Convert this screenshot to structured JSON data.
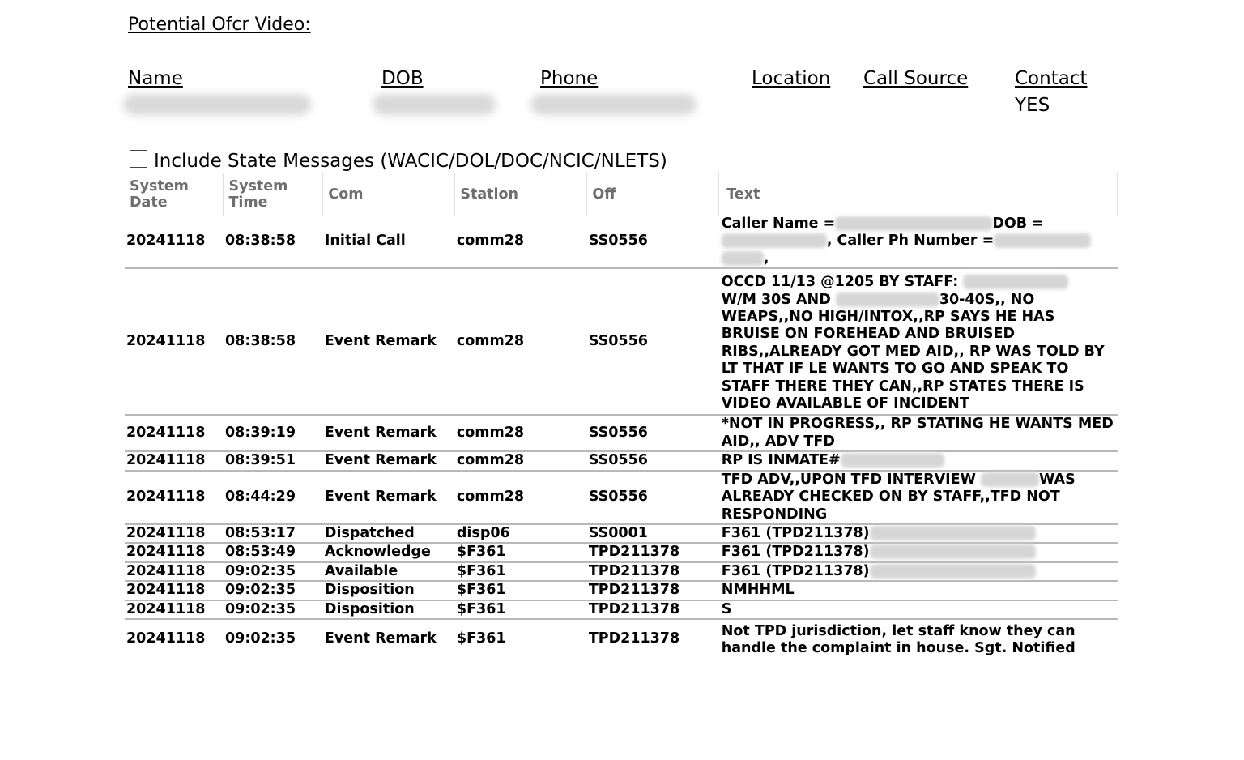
{
  "page_title": "Potential Ofcr Video:",
  "contact_headers": {
    "name": "Name",
    "dob": "DOB",
    "phone": "Phone",
    "location": "Location",
    "call_source": "Call Source",
    "contact": "Contact"
  },
  "contact_values": {
    "location": "",
    "call_source": "",
    "contact": "YES"
  },
  "include_state": {
    "label": "Include State Messages (WACIC/DOL/DOC/NCIC/NLETS)",
    "checked": false
  },
  "table": {
    "headers": {
      "system_date": "System Date",
      "system_time": "System Time",
      "com": "Com",
      "station": "Station",
      "off": "Off",
      "text": "Text"
    },
    "rows": [
      {
        "date": "20241118",
        "time": "08:38:58",
        "com": "Initial Call",
        "station": "comm28",
        "off": "SS0556",
        "text": [
          "Caller Name =",
          "DOB =",
          ", Caller Ph Number =",
          ","
        ]
      },
      {
        "date": "20241118",
        "time": "08:38:58",
        "com": "Event Remark",
        "station": "comm28",
        "off": "SS0556",
        "text": [
          "OCCD 11/13 @1205 BY STAFF:",
          "W/M 30S AND",
          "30-40S,, NO WEAPS,,NO HIGH/INTOX,,RP SAYS HE HAS BRUISE ON FOREHEAD AND BRUISED RIBS,,ALREADY GOT MED AID,, RP WAS TOLD BY LT THAT IF LE WANTS TO GO AND SPEAK TO STAFF THERE THEY CAN,,RP STATES THERE IS VIDEO AVAILABLE OF INCIDENT"
        ]
      },
      {
        "date": "20241118",
        "time": "08:39:19",
        "com": "Event Remark",
        "station": "comm28",
        "off": "SS0556",
        "text": [
          "*NOT IN PROGRESS,, RP STATING HE WANTS MED AID,, ADV TFD"
        ]
      },
      {
        "date": "20241118",
        "time": "08:39:51",
        "com": "Event Remark",
        "station": "comm28",
        "off": "SS0556",
        "text": [
          "RP IS INMATE#"
        ]
      },
      {
        "date": "20241118",
        "time": "08:44:29",
        "com": "Event Remark",
        "station": "comm28",
        "off": "SS0556",
        "text": [
          "TFD ADV,,UPON TFD INTERVIEW",
          "WAS ALREADY CHECKED ON BY STAFF,,TFD NOT RESPONDING"
        ]
      },
      {
        "date": "20241118",
        "time": "08:53:17",
        "com": "Dispatched",
        "station": "disp06",
        "off": "SS0001",
        "text": [
          "F361 (TPD211378)"
        ]
      },
      {
        "date": "20241118",
        "time": "08:53:49",
        "com": "Acknowledge",
        "station": "$F361",
        "off": "TPD211378",
        "text": [
          "F361 (TPD211378)"
        ]
      },
      {
        "date": "20241118",
        "time": "09:02:35",
        "com": "Available",
        "station": "$F361",
        "off": "TPD211378",
        "text": [
          "F361 (TPD211378)"
        ]
      },
      {
        "date": "20241118",
        "time": "09:02:35",
        "com": "Disposition",
        "station": "$F361",
        "off": "TPD211378",
        "text": [
          "NMHHML"
        ]
      },
      {
        "date": "20241118",
        "time": "09:02:35",
        "com": "Disposition",
        "station": "$F361",
        "off": "TPD211378",
        "text": [
          "S"
        ]
      },
      {
        "date": "20241118",
        "time": "09:02:35",
        "com": "Event Remark",
        "station": "$F361",
        "off": "TPD211378",
        "text": [
          "Not TPD jurisdiction, let staff know they can handle the complaint in house. Sgt. Notified"
        ]
      }
    ]
  }
}
